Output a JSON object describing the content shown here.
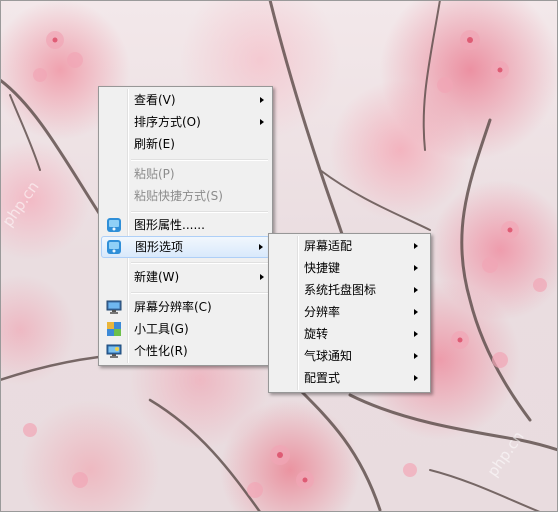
{
  "main_menu": {
    "items": [
      {
        "label": "查看(V)",
        "submenu": true,
        "enabled": true
      },
      {
        "label": "排序方式(O)",
        "submenu": true,
        "enabled": true
      },
      {
        "label": "刷新(E)",
        "submenu": false,
        "enabled": true
      },
      {
        "label": "粘贴(P)",
        "submenu": false,
        "enabled": false
      },
      {
        "label": "粘贴快捷方式(S)",
        "submenu": false,
        "enabled": false
      },
      {
        "label": "图形属性......",
        "submenu": false,
        "enabled": true,
        "icon": "intel-graphics-icon"
      },
      {
        "label": "图形选项",
        "submenu": true,
        "enabled": true,
        "icon": "intel-graphics-options-icon",
        "highlighted": true
      },
      {
        "label": "新建(W)",
        "submenu": true,
        "enabled": true
      },
      {
        "label": "屏幕分辨率(C)",
        "submenu": false,
        "enabled": true,
        "icon": "monitor-icon"
      },
      {
        "label": "小工具(G)",
        "submenu": false,
        "enabled": true,
        "icon": "gadgets-icon"
      },
      {
        "label": "个性化(R)",
        "submenu": false,
        "enabled": true,
        "icon": "personalize-icon"
      }
    ]
  },
  "sub_menu": {
    "items": [
      {
        "label": "屏幕适配",
        "submenu": true
      },
      {
        "label": "快捷键",
        "submenu": true
      },
      {
        "label": "系统托盘图标",
        "submenu": true
      },
      {
        "label": "分辨率",
        "submenu": true
      },
      {
        "label": "旋转",
        "submenu": true
      },
      {
        "label": "气球通知",
        "submenu": true
      },
      {
        "label": "配置式",
        "submenu": true
      }
    ]
  },
  "watermark": "php.cn",
  "colors": {
    "menu_bg": "#f0f0f0",
    "highlight_border": "#aecff7",
    "disabled_text": "#8c8c8c"
  }
}
